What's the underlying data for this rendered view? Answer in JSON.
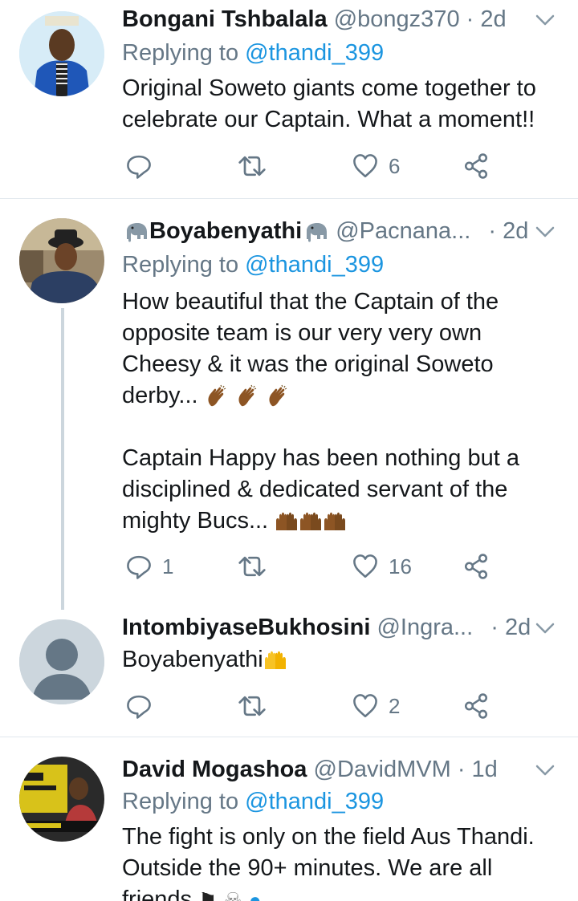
{
  "tweets": [
    {
      "name": "Bongani Tshbalala",
      "handle": "@bongz370",
      "dot": "·",
      "time": "2d",
      "reply_prefix": "Replying to",
      "reply_to": "@thandi_399",
      "lines": [
        "Original Soweto giants come together to",
        "celebrate our Captain. What a moment!!"
      ],
      "reply_count": "",
      "retweet_count": "",
      "like_count": "6"
    },
    {
      "name": "Boyabenyathi",
      "handle": "@Pacnana...",
      "dot": "·",
      "time": "2d",
      "reply_prefix": "Replying to",
      "reply_to": "@thandi_399",
      "lines": [
        "How beautiful that the Captain of the",
        "opposite team is our very very own",
        "Cheesy & it was the original Soweto",
        "derby...",
        "",
        "Captain Happy has been nothing but a",
        "disciplined & dedicated servant of the",
        "mighty Bucs..."
      ],
      "reply_count": "1",
      "retweet_count": "",
      "like_count": "16"
    },
    {
      "name": "IntombiyaseBukhosini",
      "handle": "@Ingra...",
      "dot": "·",
      "time": "2d",
      "lines": [
        "Boyabenyathi"
      ],
      "reply_count": "",
      "retweet_count": "",
      "like_count": "2"
    },
    {
      "name": "David Mogashoa",
      "handle": "@DavidMVM",
      "dot": "·",
      "time": "1d",
      "reply_prefix": "Replying to",
      "reply_to": "@thandi_399",
      "lines": [
        "The fight is only on the field Aus Thandi.",
        "Outside the 90+ minutes. We are all",
        "friends"
      ]
    }
  ],
  "colors": {
    "link": "#1b95e0",
    "muted": "#657786",
    "separator": "#e1e8ed",
    "thread": "#ccd6dd"
  },
  "icons": [
    "reply-icon",
    "retweet-icon",
    "like-icon",
    "share-icon",
    "chevron-down-icon",
    "elephant-emoji",
    "clapping-hands-emoji",
    "raising-hands-emoji"
  ]
}
